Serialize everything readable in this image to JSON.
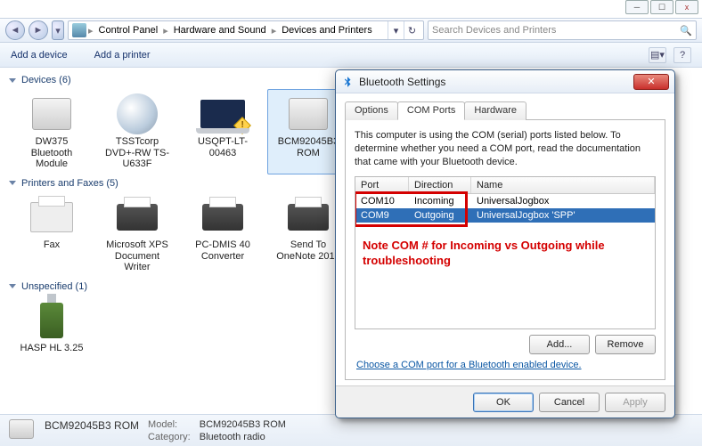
{
  "window_controls": {
    "min": "─",
    "max": "☐",
    "close": "x"
  },
  "breadcrumb": {
    "items": [
      "Control Panel",
      "Hardware and Sound",
      "Devices and Printers"
    ]
  },
  "search": {
    "placeholder": "Search Devices and Printers"
  },
  "cmdbar": {
    "add_device": "Add a device",
    "add_printer": "Add a printer"
  },
  "sections": {
    "devices": {
      "title": "Devices (6)",
      "items": [
        {
          "label": "DW375 Bluetooth Module"
        },
        {
          "label": "TSSTcorp DVD+-RW TS-U633F"
        },
        {
          "label": "USQPT-LT-00463"
        },
        {
          "label": "BCM92045B3 ROM"
        }
      ]
    },
    "printers": {
      "title": "Printers and Faxes (5)",
      "items": [
        {
          "label": "Fax"
        },
        {
          "label": "Microsoft XPS Document Writer"
        },
        {
          "label": "PC-DMIS 40 Converter"
        },
        {
          "label": "Send To OneNote 2010"
        }
      ]
    },
    "unspecified": {
      "title": "Unspecified (1)",
      "items": [
        {
          "label": "HASP HL 3.25"
        }
      ]
    }
  },
  "details": {
    "name": "BCM92045B3 ROM",
    "model_key": "Model:",
    "model_val": "BCM92045B3 ROM",
    "category_key": "Category:",
    "category_val": "Bluetooth radio"
  },
  "dialog": {
    "title": "Bluetooth Settings",
    "tabs": {
      "options": "Options",
      "com": "COM Ports",
      "hardware": "Hardware"
    },
    "desc": "This computer is using the COM (serial) ports listed below. To determine whether you need a COM port, read the documentation that came with your Bluetooth device.",
    "columns": {
      "port": "Port",
      "direction": "Direction",
      "name": "Name"
    },
    "rows": [
      {
        "port": "COM10",
        "direction": "Incoming",
        "name": "UniversalJogbox"
      },
      {
        "port": "COM9",
        "direction": "Outgoing",
        "name": "UniversalJogbox 'SPP'"
      }
    ],
    "annotation": "Note COM # for Incoming vs Outgoing while troubleshooting",
    "add": "Add...",
    "remove": "Remove",
    "link": "Choose a COM port for a Bluetooth enabled device.",
    "ok": "OK",
    "cancel": "Cancel",
    "apply": "Apply"
  }
}
